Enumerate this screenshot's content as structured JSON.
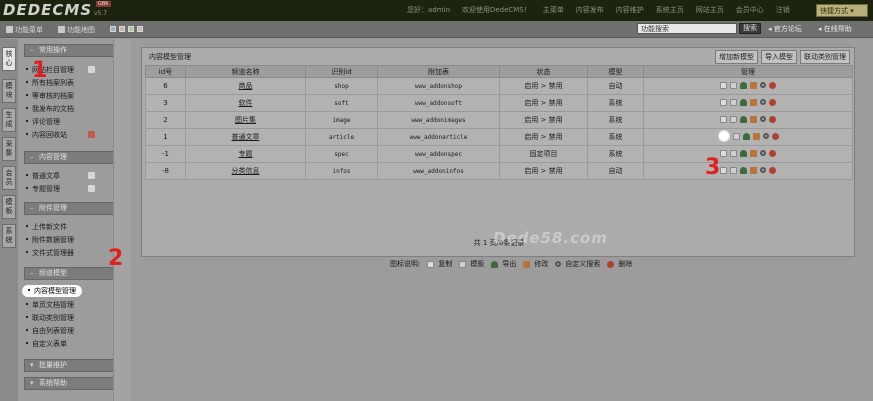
{
  "header": {
    "logo": "DEDECMS",
    "version": "v5.7",
    "badge": "GBK",
    "nav": [
      "您好：admin",
      "欢迎使用DedeCMS！",
      "主菜单",
      "内容发布",
      "内容维护",
      "系统主页",
      "网站主页",
      "会员中心",
      "注销"
    ],
    "quick_menu": "快捷方式 ▾"
  },
  "toolbar": {
    "items": [
      "功能菜单",
      "功能地图"
    ],
    "search_value": "功能搜索",
    "search_button": "搜索",
    "official_forum": "官方论坛",
    "online_help": "在线帮助"
  },
  "vtabs": [
    "核心",
    "模块",
    "生成",
    "采集",
    "会员",
    "模板",
    "系统"
  ],
  "sidebar": {
    "groups": [
      {
        "title": "常用操作",
        "items": [
          "网站栏目管理",
          "所有档案列表",
          "等审核的档案",
          "我发布的文档",
          "评论管理",
          "内容回收站"
        ]
      },
      {
        "title": "内容管理",
        "items": [
          "普通文章",
          "专题管理"
        ]
      },
      {
        "title": "附件管理",
        "items": [
          "上传新文件",
          "附件数据管理",
          "文件式管理器"
        ]
      },
      {
        "title": "频道模型",
        "items": [
          "内容模型管理",
          "单页文档管理",
          "联动类别管理",
          "自由列表管理",
          "自定义表单"
        ]
      },
      {
        "title": "批量维护",
        "items": []
      },
      {
        "title": "系统帮助",
        "items": []
      }
    ]
  },
  "panel": {
    "title": "内容模型管理",
    "actions": [
      "增加新模型",
      "导入模型",
      "联动类别管理"
    ],
    "columns": [
      "id号",
      "频道名称",
      "识别id",
      "附加表",
      "状态",
      "模型",
      "管理"
    ],
    "rows": [
      {
        "id": "6",
        "name": "商品",
        "nid": "shop",
        "table": "www_addonshop",
        "status": "启用 > 禁用",
        "model": "自动"
      },
      {
        "id": "3",
        "name": "软件",
        "nid": "soft",
        "table": "www_addonsoft",
        "status": "启用 > 禁用",
        "model": "系统"
      },
      {
        "id": "2",
        "name": "图片集",
        "nid": "image",
        "table": "www_addonimages",
        "status": "启用 > 禁用",
        "model": "系统"
      },
      {
        "id": "1",
        "name": "普通文章",
        "nid": "article",
        "table": "www_addonarticle",
        "status": "启用 > 禁用",
        "model": "系统"
      },
      {
        "id": "-1",
        "name": "专题",
        "nid": "spec",
        "table": "www_addonspec",
        "status": "固定项目",
        "model": "系统"
      },
      {
        "id": "-8",
        "name": "分类信息",
        "nid": "infos",
        "table": "www_addoninfos",
        "status": "启用 > 禁用",
        "model": "自动"
      }
    ],
    "pager": "共 1 页/6条记录",
    "legend_label": "图标说明:",
    "legend": [
      "复制",
      "模板",
      "导出",
      "修改",
      "自定义搜索",
      "删除"
    ]
  },
  "watermark": "Dede58.com",
  "annotations": [
    "1",
    "2",
    "3"
  ],
  "colors": {
    "header_bg": "#1c2410",
    "panel_bg": "#ababab",
    "marker": "#e02020"
  }
}
